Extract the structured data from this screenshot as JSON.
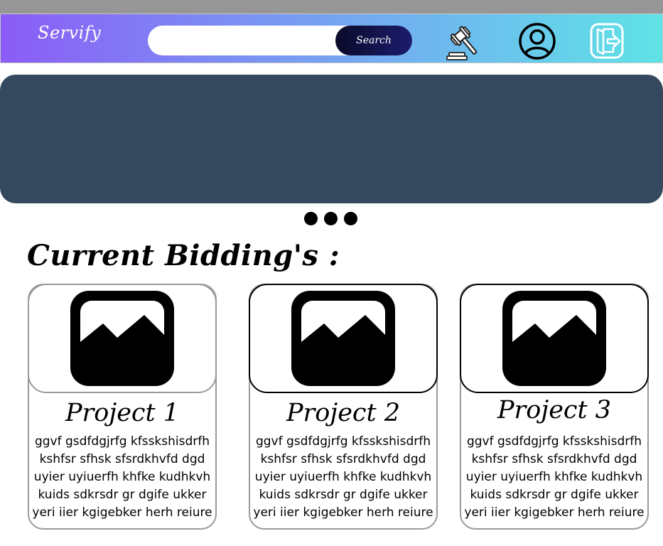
{
  "header": {
    "logo": "Servify",
    "search": {
      "value": "",
      "placeholder": "",
      "button_label": "Search"
    },
    "icons": [
      "gavel-icon",
      "profile-icon",
      "logout-icon"
    ]
  },
  "colors": {
    "navbar_gradient": [
      "#8b5cf6",
      "#5fe3e6"
    ],
    "banner": "#35495e",
    "search_button": "#0a0a2a"
  },
  "carousel": {
    "dot_count": 3
  },
  "section": {
    "title": "Current Bidding's :"
  },
  "projects": [
    {
      "title": "Project 1",
      "description": "ggvf gsdfdgjrfg kfsskshisdrfh kshfsr sfhsk sfsrdkhvfd dgd uyier uyiuerfh khfke kudhkvh kuids sdkrsdr gr dgife ukker yeri iier kgigebker herh reiure"
    },
    {
      "title": "Project 2",
      "description": "ggvf gsdfdgjrfg kfsskshisdrfh kshfsr sfhsk sfsrdkhvfd dgd uyier uyiuerfh khfke kudhkvh kuids sdkrsdr gr dgife ukker yeri iier kgigebker herh reiure"
    },
    {
      "title": "Project 3",
      "description": "ggvf gsdfdgjrfg kfsskshisdrfh kshfsr sfhsk sfsrdkhvfd dgd uyier uyiuerfh khfke kudhkvh kuids sdkrsdr gr dgife ukker yeri iier kgigebker herh reiure"
    }
  ]
}
